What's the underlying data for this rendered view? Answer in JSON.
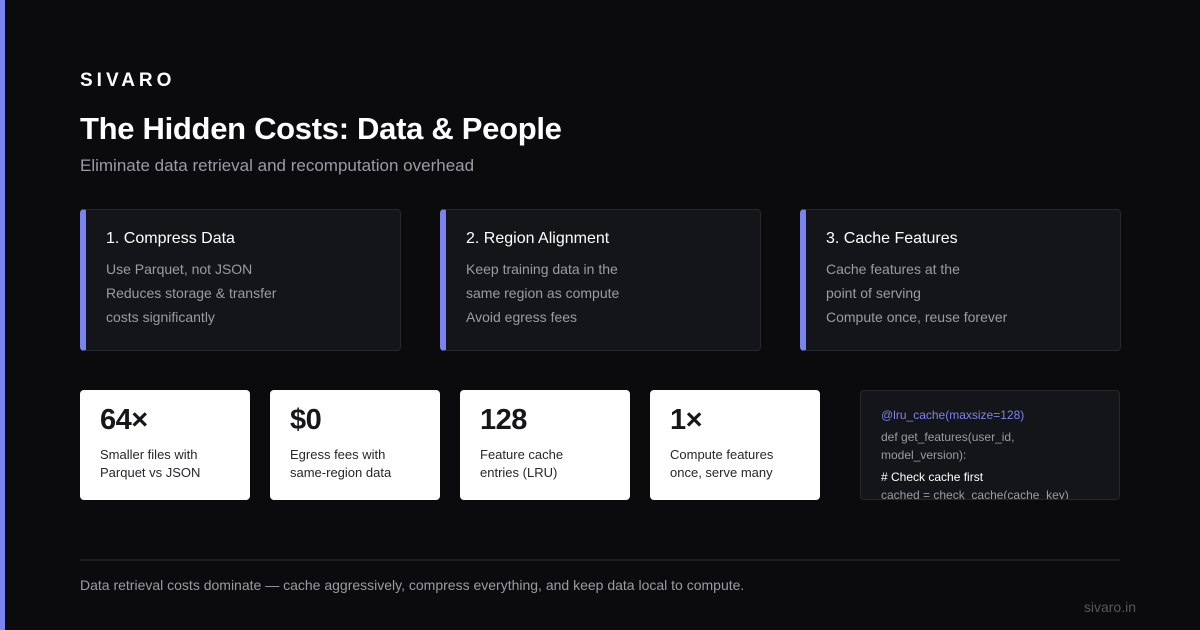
{
  "brand": "SIVARO",
  "title": "The Hidden Costs: Data & People",
  "subtitle": "Eliminate data retrieval and recomputation overhead",
  "steps": [
    {
      "title": "1. Compress Data",
      "lines": [
        "Use Parquet, not JSON",
        "Reduces storage & transfer",
        "costs significantly"
      ]
    },
    {
      "title": "2. Region Alignment",
      "lines": [
        "Keep training data in the",
        "same region as compute",
        "Avoid egress fees"
      ]
    },
    {
      "title": "3. Cache Features",
      "lines": [
        "Cache features at the",
        "point of serving",
        "Compute once, reuse forever"
      ]
    }
  ],
  "stats": [
    {
      "value": "64×",
      "label_lines": [
        "Smaller files with",
        "Parquet vs JSON"
      ]
    },
    {
      "value": "$0",
      "label_lines": [
        "Egress fees with",
        "same-region data"
      ]
    },
    {
      "value": "128",
      "label_lines": [
        "Feature cache",
        "entries (LRU)"
      ]
    },
    {
      "value": "1×",
      "label_lines": [
        "Compute features",
        "once, serve many"
      ]
    }
  ],
  "code": {
    "decorator": "@lru_cache(maxsize=128)",
    "def_line_1": "def get_features(user_id,",
    "def_line_2": "model_version):",
    "comment": "# Check cache first",
    "statement": "cached = check_cache(cache_key)"
  },
  "footer": {
    "text": "Data retrieval costs dominate — cache aggressively, compress everything, and keep data local to compute.",
    "url": "sivaro.in"
  },
  "colors": {
    "accent": "#7b83ee",
    "background": "#0b0b0d",
    "card": "#141518"
  }
}
